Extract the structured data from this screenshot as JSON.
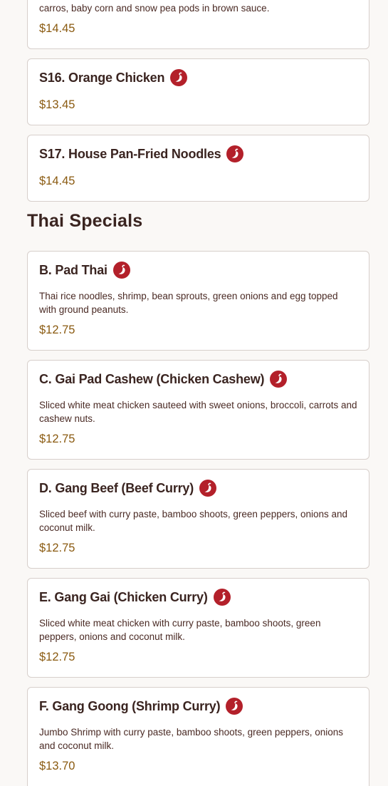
{
  "colors": {
    "background": "#faf8f6",
    "price": "#8a5a10",
    "spicy_icon": "#b3202a",
    "card_border": "#d7cfcb"
  },
  "icons": {
    "spicy": "chili-pepper-icon"
  },
  "top_card": {
    "desc_tail": "carros, baby corn and snow pea pods in brown sauce.",
    "price": "$14.45"
  },
  "specials": [
    {
      "title": "S16. Orange Chicken",
      "price": "$13.45",
      "spicy": true
    },
    {
      "title": "S17. House Pan-Fried Noodles",
      "price": "$14.45",
      "spicy": true
    }
  ],
  "thai_section": {
    "heading": "Thai Specials",
    "items": [
      {
        "title": "B. Pad Thai",
        "desc": "Thai rice noodles, shrimp, bean sprouts, green onions and egg topped with ground peanuts.",
        "price": "$12.75",
        "spicy": true
      },
      {
        "title": "C. Gai Pad Cashew (Chicken Cashew)",
        "desc": "Sliced white meat chicken sauteed with sweet onions, broccoli, carrots and cashew nuts.",
        "price": "$12.75",
        "spicy": true
      },
      {
        "title": "D. Gang Beef (Beef Curry)",
        "desc": "Sliced beef with curry paste, bamboo shoots, green peppers, onions and coconut milk.",
        "price": "$12.75",
        "spicy": true
      },
      {
        "title": "E. Gang Gai (Chicken Curry)",
        "desc": "Sliced white meat chicken with curry paste, bamboo shoots, green peppers, onions and coconut milk.",
        "price": "$12.75",
        "spicy": true
      },
      {
        "title": "F. Gang Goong (Shrimp Curry)",
        "desc": "Jumbo Shrimp with curry paste, bamboo shoots, green peppers, onions and coconut milk.",
        "price": "$13.70",
        "spicy": true
      }
    ]
  }
}
